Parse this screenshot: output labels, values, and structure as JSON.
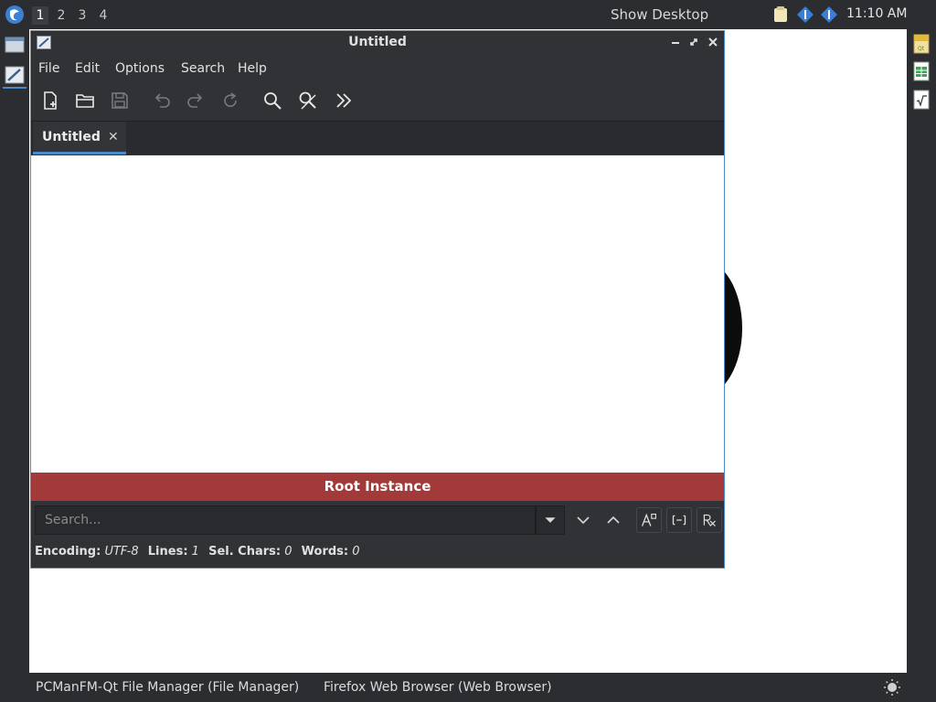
{
  "top_panel": {
    "workspaces": [
      "1",
      "2",
      "3",
      "4"
    ],
    "active_workspace": "1",
    "show_desktop": "Show Desktop",
    "clock": "11:10 AM"
  },
  "window": {
    "title": "Untitled",
    "menu": [
      "File",
      "Edit",
      "Options",
      "Search",
      "Help"
    ],
    "tab_label": "Untitled",
    "tab_close": "✕",
    "root_banner": "Root Instance",
    "search_placeholder": "Search...",
    "status": {
      "encoding_label": "Encoding:",
      "encoding_value": "UTF-8",
      "lines_label": "Lines:",
      "lines_value": "1",
      "sel_label": "Sel. Chars:",
      "sel_value": "0",
      "words_label": "Words:",
      "words_value": "0"
    }
  },
  "taskbar": {
    "tasks": [
      "PCManFM-Qt File Manager (File Manager)",
      "Firefox Web Browser (Web Browser)"
    ]
  },
  "colors": {
    "panel": "#2b2d30",
    "window_bg": "#303235",
    "accent": "#4a88c7",
    "root_banner": "#a33a3a"
  },
  "icons": {
    "toolbar": [
      "new-file-icon",
      "open-folder-icon",
      "save-icon",
      "undo-icon",
      "redo-icon",
      "reload-icon",
      "find-icon",
      "replace-icon",
      "more-icon"
    ],
    "search": [
      "dropdown-icon",
      "next-icon",
      "previous-icon",
      "match-case-icon",
      "whole-word-icon",
      "regex-icon"
    ]
  }
}
